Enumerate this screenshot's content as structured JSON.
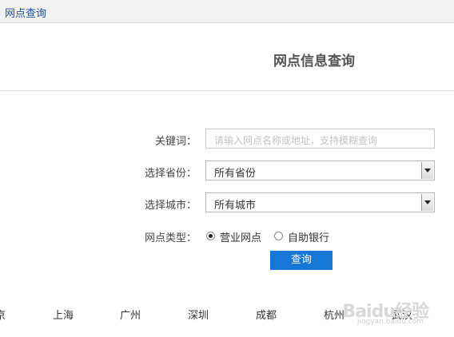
{
  "breadcrumb": "网点查询",
  "title": "网点信息查询",
  "form": {
    "keyword_label": "关键词：",
    "keyword_placeholder": "请输入网点名称或地址，支持模糊查询",
    "province_label": "选择省份：",
    "province_value": "所有省份",
    "city_label": "选择城市：",
    "city_value": "所有城市",
    "type_label": "网点类型：",
    "types": [
      {
        "label": "营业网点",
        "selected": true
      },
      {
        "label": "自助银行",
        "selected": false
      }
    ],
    "submit_label": "查询"
  },
  "cities": [
    "京",
    "上海",
    "广州",
    "深圳",
    "成都",
    "杭州",
    "武汉"
  ],
  "watermark": {
    "text": "Baidu经验",
    "sub": "jingyan.baidu.com"
  },
  "colors": {
    "accent": "#1777d6",
    "breadcrumb": "#1a4f9c"
  }
}
